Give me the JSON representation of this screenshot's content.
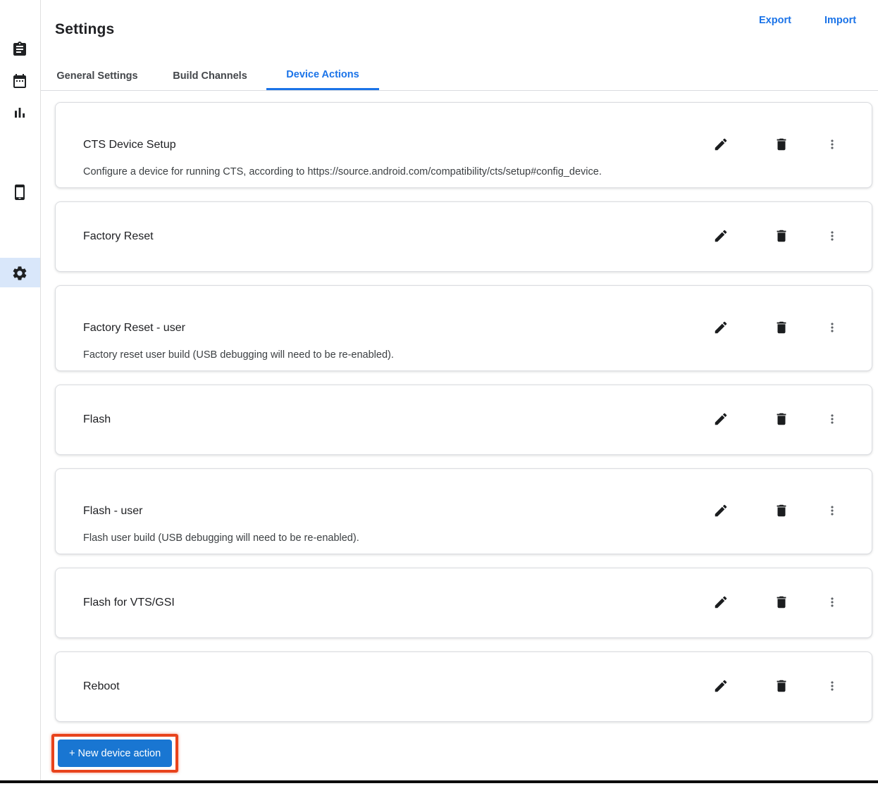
{
  "header": {
    "title": "Settings",
    "export_label": "Export",
    "import_label": "Import"
  },
  "tabs": [
    {
      "label": "General Settings",
      "active": false
    },
    {
      "label": "Build Channels",
      "active": false
    },
    {
      "label": "Device Actions",
      "active": true
    }
  ],
  "device_actions": [
    {
      "name": "CTS Device Setup",
      "description": "Configure a device for running CTS, according to https://source.android.com/compatibility/cts/setup#config_device."
    },
    {
      "name": "Factory Reset",
      "description": ""
    },
    {
      "name": "Factory Reset - user",
      "description": "Factory reset user build (USB debugging will need to be re-enabled)."
    },
    {
      "name": "Flash",
      "description": ""
    },
    {
      "name": "Flash - user",
      "description": "Flash user build (USB debugging will need to be re-enabled)."
    },
    {
      "name": "Flash for VTS/GSI",
      "description": ""
    },
    {
      "name": "Reboot",
      "description": ""
    }
  ],
  "card_action_icons": [
    "pencil-icon",
    "trash-icon",
    "more-vert-icon"
  ],
  "new_action_button": {
    "label": "+ New device action"
  },
  "sidebar": {
    "icons": [
      {
        "icon": "assignment-icon",
        "active": false
      },
      {
        "icon": "calendar-icon",
        "active": false
      },
      {
        "icon": "bar-chart-icon",
        "active": false
      },
      {
        "icon": "smartphone-icon",
        "active": false
      },
      {
        "icon": "gear-icon",
        "active": true
      }
    ]
  },
  "colors": {
    "link_blue": "#1a73e8",
    "active_tab_blue": "#1a73e8",
    "button_blue": "#1976d2",
    "annotation_red": "#e8431c",
    "sidebar_active_bg": "#d9e7fa"
  }
}
